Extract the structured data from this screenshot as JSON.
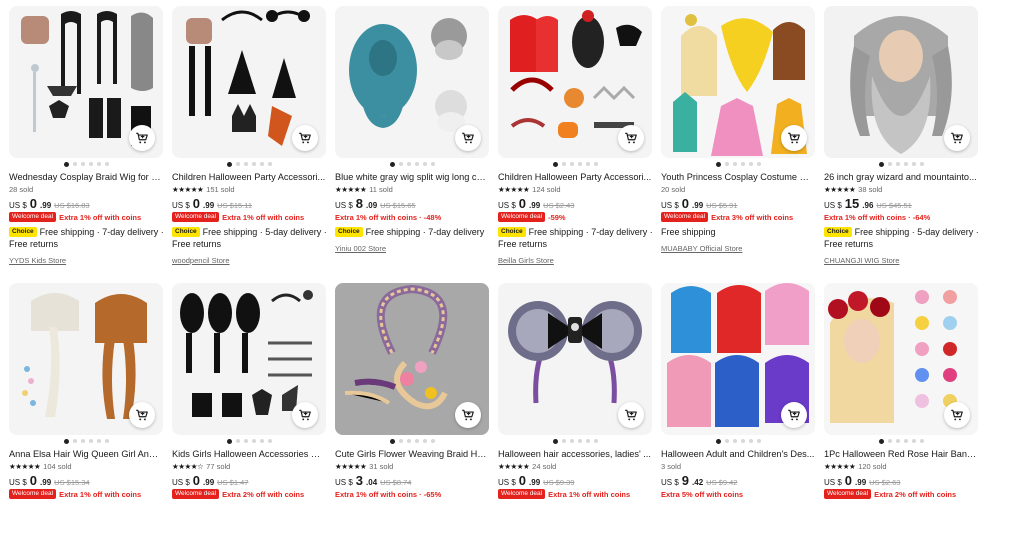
{
  "products": [
    {
      "title": "Wednesday Cosplay Braid Wig for Ki...",
      "sold": "28 sold",
      "stars": 0,
      "currency": "US $",
      "price_int": "0",
      "price_dec": ".99",
      "orig": "US $16.83",
      "welcome": "Welcome deal",
      "promo": "Extra 1% off with coins",
      "choice": "Choice",
      "shipping": "Free shipping · 7-day delivery ·",
      "returns": "Free returns",
      "store": "YYDS Kids Store"
    },
    {
      "title": "Children Halloween Party Accessori...",
      "sold": "151 sold",
      "stars": 4.5,
      "currency": "US $",
      "price_int": "0",
      "price_dec": ".99",
      "orig": "US $15.11",
      "welcome": "Welcome deal",
      "promo": "Extra 1% off with coins",
      "choice": "Choice",
      "shipping": "Free shipping · 5-day delivery ·",
      "returns": "Free returns",
      "store": "woodpencil Store"
    },
    {
      "title": "Blue white gray wig split wig long cu...",
      "sold": "11 sold",
      "stars": 5,
      "currency": "US $",
      "price_int": "8",
      "price_dec": ".09",
      "orig": "US $15.65",
      "welcome": "",
      "promo": "Extra 1% off with coins · -48%",
      "choice": "Choice",
      "shipping": "Free shipping · 7-day delivery",
      "returns": "",
      "store": "Yiniu 002 Store"
    },
    {
      "title": "Children Halloween Party Accessori...",
      "sold": "124 sold",
      "stars": 4.5,
      "currency": "US $",
      "price_int": "0",
      "price_dec": ".99",
      "orig": "US $2.43",
      "welcome": "Welcome deal",
      "promo": "-59%",
      "choice": "Choice",
      "shipping": "Free shipping · 7-day delivery ·",
      "returns": "Free returns",
      "store": "Beilla Girls Store"
    },
    {
      "title": "Youth Princess Cosplay Costume Cr...",
      "sold": "20 sold",
      "stars": 0,
      "currency": "US $",
      "price_int": "0",
      "price_dec": ".99",
      "orig": "US $5.91",
      "welcome": "Welcome deal",
      "promo": "Extra 3% off with coins",
      "choice": "",
      "shipping": "Free shipping",
      "returns": "",
      "store": "MUABABY Official Store"
    },
    {
      "title": "26 inch gray wizard and mountainto...",
      "sold": "38 sold",
      "stars": 5,
      "currency": "US $",
      "price_int": "15",
      "price_dec": ".96",
      "orig": "US $45.51",
      "welcome": "",
      "promo": "Extra 1% off with coins · -64%",
      "choice": "Choice",
      "shipping": "Free shipping · 5-day delivery ·",
      "returns": "Free returns",
      "store": "CHUANGJI WIG Store"
    },
    {
      "title": "Anna Elsa Hair Wig Queen Girl Anna...",
      "sold": "104 sold",
      "stars": 5,
      "currency": "US $",
      "price_int": "0",
      "price_dec": ".99",
      "orig": "US $15.34",
      "welcome": "Welcome deal",
      "promo": "Extra 1% off with coins",
      "choice": "",
      "shipping": "",
      "returns": "",
      "store": ""
    },
    {
      "title": "Kids Girls Halloween Accessories Pr...",
      "sold": "77 sold",
      "stars": 4,
      "currency": "US $",
      "price_int": "0",
      "price_dec": ".99",
      "orig": "US $1.47",
      "welcome": "Welcome deal",
      "promo": "Extra 2% off with coins",
      "choice": "",
      "shipping": "",
      "returns": "",
      "store": ""
    },
    {
      "title": "Cute Girls Flower Weaving Braid He...",
      "sold": "31 sold",
      "stars": 5,
      "currency": "US $",
      "price_int": "3",
      "price_dec": ".04",
      "orig": "US $8.74",
      "welcome": "",
      "promo": "Extra 1% off with coins · -65%",
      "choice": "",
      "shipping": "",
      "returns": "",
      "store": ""
    },
    {
      "title": "Halloween hair accessories, ladies' ...",
      "sold": "24 sold",
      "stars": 5,
      "currency": "US $",
      "price_int": "0",
      "price_dec": ".99",
      "orig": "US $9.39",
      "welcome": "Welcome deal",
      "promo": "Extra 1% off with coins",
      "choice": "",
      "shipping": "",
      "returns": "",
      "store": ""
    },
    {
      "title": "Halloween Adult and Children's Des...",
      "sold": "3 sold",
      "stars": 0,
      "currency": "US $",
      "price_int": "9",
      "price_dec": ".42",
      "orig": "US $9.42",
      "welcome": "",
      "promo": "Extra 5% off with coins",
      "choice": "",
      "shipping": "",
      "returns": "",
      "store": ""
    },
    {
      "title": "1Pc Halloween Red Rose Hair Band ...",
      "sold": "120 sold",
      "stars": 5,
      "currency": "US $",
      "price_int": "0",
      "price_dec": ".99",
      "orig": "US $2.63",
      "welcome": "Welcome deal",
      "promo": "Extra 2% off with coins",
      "choice": "",
      "shipping": "",
      "returns": "",
      "store": ""
    }
  ],
  "icons": {
    "cart": "add-to-cart-icon",
    "star": "star-icon"
  },
  "colors": {
    "accent_red": "#e4221d",
    "choice_yellow": "#ffe400",
    "text": "#191919",
    "muted": "#999999"
  }
}
